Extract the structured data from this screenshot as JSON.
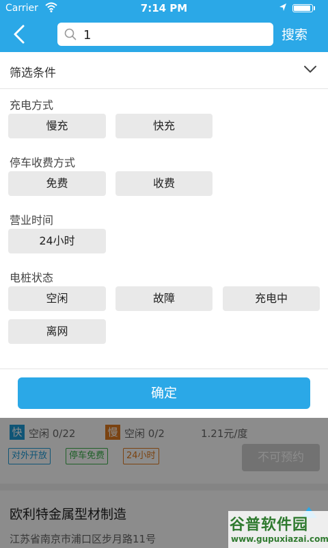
{
  "status_bar": {
    "carrier": "Carrier",
    "time": "7:14 PM"
  },
  "nav": {
    "search_value": "1",
    "search_button": "搜索"
  },
  "filter": {
    "title": "筛选条件",
    "sections": [
      {
        "label": "充电方式",
        "options": [
          "慢充",
          "快充"
        ]
      },
      {
        "label": "停车收费方式",
        "options": [
          "免费",
          "收费"
        ]
      },
      {
        "label": "营业时间",
        "options": [
          "24小时"
        ]
      },
      {
        "label": "电桩状态",
        "options": [
          "空闲",
          "故障",
          "充电中",
          "离网"
        ]
      }
    ],
    "confirm": "确定"
  },
  "station": {
    "fast_tag": "快",
    "fast_status": "空闲 0/22",
    "slow_tag": "慢",
    "slow_status": "空闲 0/2",
    "price": "1.21元/度",
    "tags": [
      "对外开放",
      "停车免费",
      "24小时"
    ],
    "reserve_button": "不可预约",
    "name": "欧利特金属型材制造",
    "address": "江苏省南京市浦口区步月路11号"
  },
  "watermark": {
    "title": "谷普软件园",
    "url": "www.gupuxiazai.com"
  },
  "colors": {
    "accent": "#2ba8e7",
    "option_bg": "#e9e9e9",
    "fast": "#1e9bd7",
    "slow": "#e07b1f",
    "green": "#3bb04a"
  }
}
